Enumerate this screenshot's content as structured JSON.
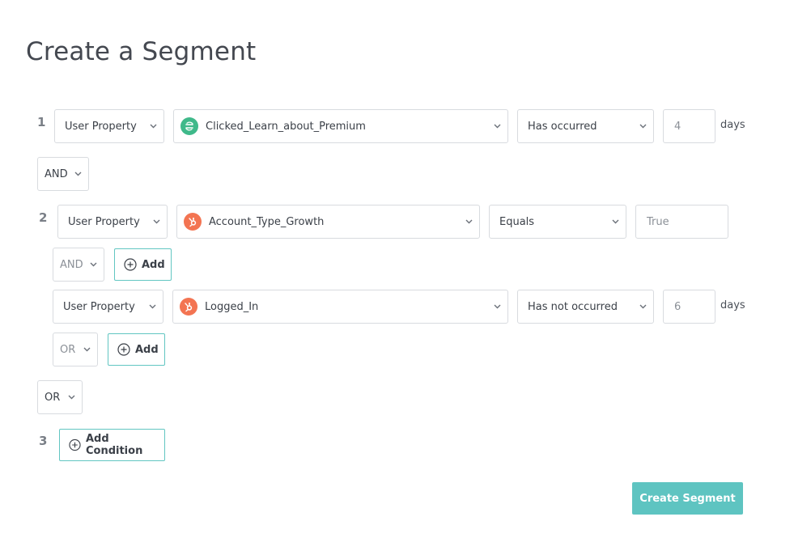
{
  "page": {
    "title": "Create a Segment"
  },
  "conditions": [
    {
      "number": "1",
      "property_type": "User Property",
      "event": "Clicked_Learn_about_Premium",
      "event_icon": "segment-green-icon",
      "operator": "Has occurred",
      "value": "4",
      "unit": "days"
    },
    {
      "number": "2",
      "property_type": "User Property",
      "event": "Account_Type_Growth",
      "event_icon": "hubspot-orange-icon",
      "operator": "Equals",
      "value_placeholder": "True",
      "inner_join": "AND",
      "add_label": "Add",
      "sub": {
        "property_type": "User Property",
        "event": "Logged_In",
        "event_icon": "hubspot-orange-icon",
        "operator": "Has not occurred",
        "value": "6",
        "unit": "days",
        "inner_join": "OR",
        "add_label": "Add"
      }
    },
    {
      "number": "3",
      "add_condition_label": "Add Condition"
    }
  ],
  "joins": [
    "AND",
    "OR"
  ],
  "actions": {
    "create_label": "Create Segment"
  },
  "colors": {
    "accent": "#5ec4c1",
    "border_accent": "#62c6c2",
    "segment_green": "#3fb98a",
    "hubspot_orange": "#f37452"
  }
}
